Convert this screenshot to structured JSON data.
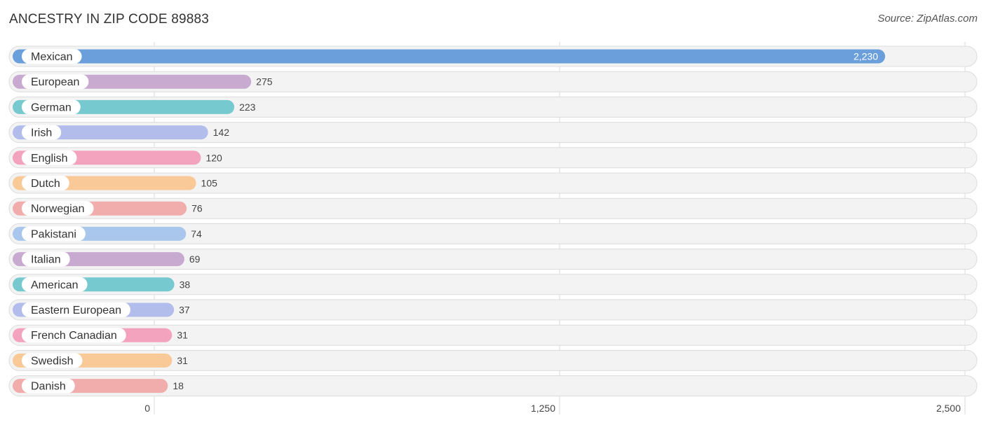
{
  "chart_data": {
    "type": "bar",
    "orientation": "horizontal",
    "title": "ANCESTRY IN ZIP CODE 89883",
    "source": "Source: ZipAtlas.com",
    "categories": [
      "Mexican",
      "European",
      "German",
      "Irish",
      "English",
      "Dutch",
      "Norwegian",
      "Pakistani",
      "Italian",
      "American",
      "Eastern European",
      "French Canadian",
      "Swedish",
      "Danish"
    ],
    "values": [
      2230,
      275,
      223,
      142,
      120,
      105,
      76,
      74,
      69,
      38,
      37,
      31,
      31,
      18
    ],
    "value_labels": [
      "2,230",
      "275",
      "223",
      "142",
      "120",
      "105",
      "76",
      "74",
      "69",
      "38",
      "37",
      "31",
      "31",
      "18"
    ],
    "colors": [
      "#6a9fdc",
      "#c8a9d0",
      "#76c9cf",
      "#b3bdeb",
      "#f4a3bf",
      "#f9c998",
      "#f0adab",
      "#a9c7ec",
      "#c8a9d0",
      "#76c9cf",
      "#b3bdeb",
      "#f4a3bf",
      "#f9c998",
      "#f0adab"
    ],
    "xlim": [
      0,
      2500
    ],
    "xticks": [
      0,
      1250,
      2500
    ],
    "xtick_labels": [
      "0",
      "1,250",
      "2,500"
    ],
    "xlabel": "",
    "ylabel": "",
    "grid": true,
    "legend": "none"
  }
}
